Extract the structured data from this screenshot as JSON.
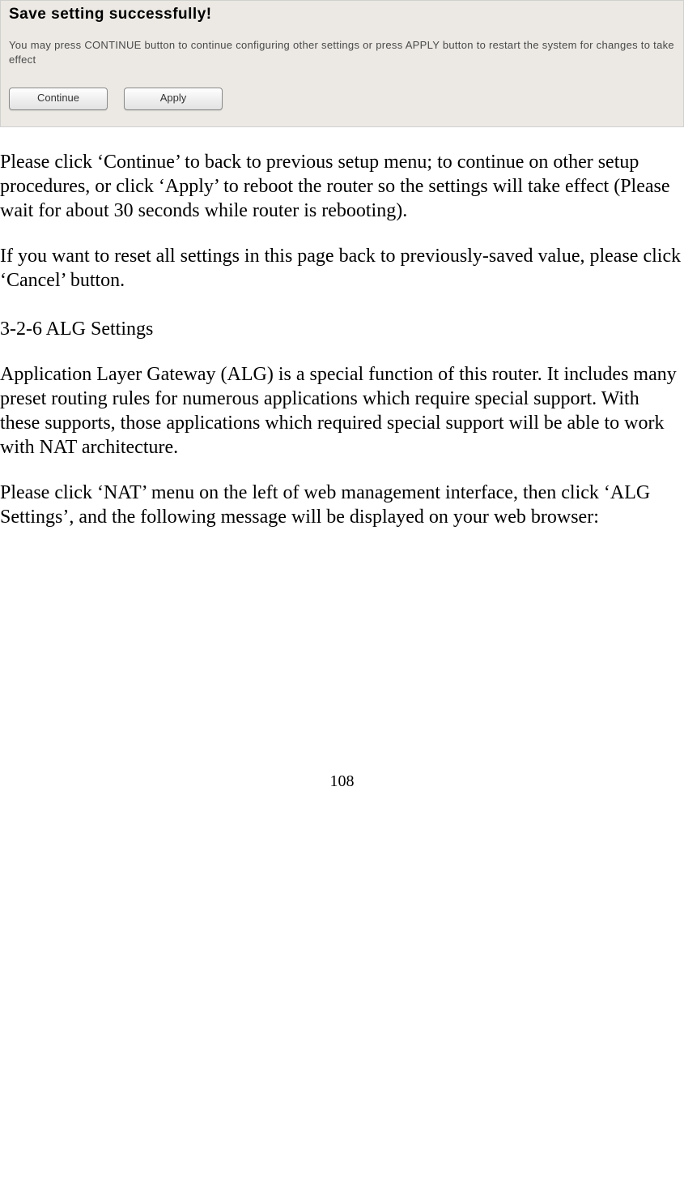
{
  "screenshot": {
    "title": "Save setting successfully!",
    "description": "You may press CONTINUE button to continue configuring other settings or press APPLY button to restart the system for changes to take effect",
    "continue_label": "Continue",
    "apply_label": "Apply"
  },
  "doc": {
    "para1": "Please click ‘Continue’ to back to previous setup menu; to continue on other setup procedures, or click ‘Apply’ to reboot the router so the settings will take effect (Please wait for about 30 seconds while router is rebooting).",
    "para2": "If you want to reset all settings in this page back to previously-saved value, please click ‘Cancel’ button.",
    "heading": "3-2-6 ALG Settings",
    "para3": "Application Layer Gateway (ALG) is a special function of this router. It includes many preset routing rules for numerous applications which require special support. With these supports, those applications which required special support will be able to work with NAT architecture.",
    "para4": "Please click ‘NAT’ menu on the left of web management interface, then click ‘ALG Settings’, and the following message will be displayed on your web browser:"
  },
  "page_number": "108"
}
